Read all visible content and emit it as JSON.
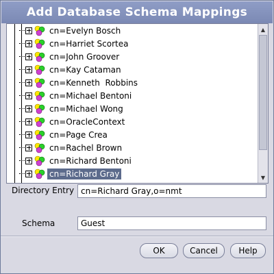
{
  "window": {
    "title": "Add Database Schema Mappings"
  },
  "tree": {
    "items": [
      {
        "label": "cn=Evelyn Bosch"
      },
      {
        "label": "cn=Harriet Scortea"
      },
      {
        "label": "cn=John Groover"
      },
      {
        "label": "cn=Kay Cataman"
      },
      {
        "label": "cn=Kenneth  Robbins"
      },
      {
        "label": "cn=Michael Bentoni"
      },
      {
        "label": "cn=Michael Wong"
      },
      {
        "label": "cn=OracleContext"
      },
      {
        "label": "cn=Page Crea"
      },
      {
        "label": "cn=Rachel Brown"
      },
      {
        "label": "cn=Richard Bentoni"
      },
      {
        "label": "cn=Richard Gray"
      }
    ],
    "selected_label": "cn=Richard Gray",
    "node_icon": "directory-entry-icon",
    "colors": {
      "selection": "#5c6b8c",
      "title_bar": "#8593be"
    }
  },
  "form": {
    "directory_entry_label": "Directory Entry",
    "directory_entry_value": "cn=Richard Gray,o=nmt",
    "schema_label": "Schema",
    "schema_value": "Guest"
  },
  "buttons": {
    "ok": "OK",
    "cancel": "Cancel",
    "help": "Help"
  }
}
